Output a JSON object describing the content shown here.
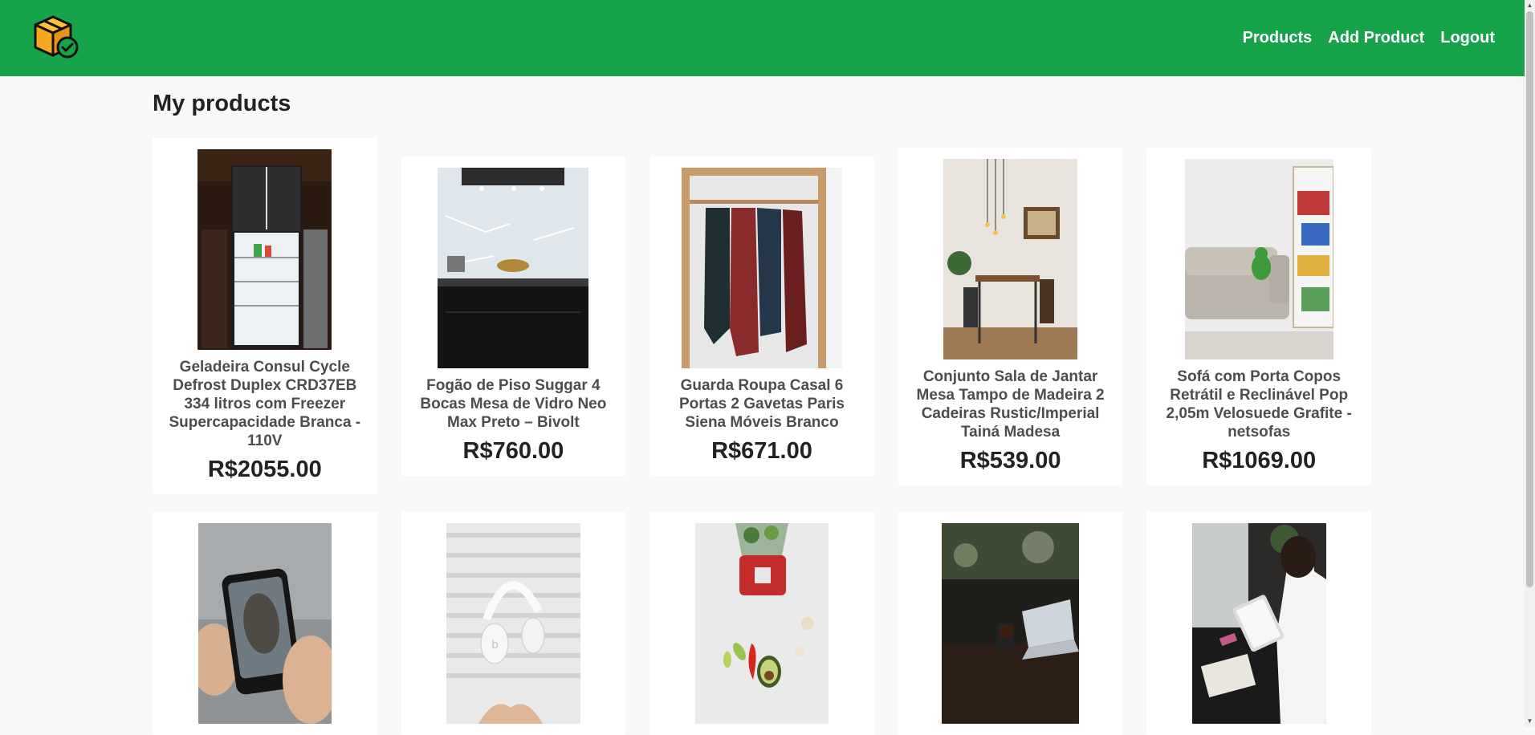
{
  "navbar": {
    "links": [
      "Products",
      "Add Product",
      "Logout"
    ],
    "brand_color": "#17a34a",
    "logo_icon": "package-check-icon"
  },
  "page": {
    "title": "My products"
  },
  "products": [
    {
      "name": "Geladeira Consul Cycle Defrost Duplex CRD37EB 334 litros com Freezer Supercapacidade Branca - 110V",
      "price": "R$2055.00",
      "image": "refrigerator-photo"
    },
    {
      "name": "Fogão de Piso Suggar 4 Bocas Mesa de Vidro Neo Max Preto – Bivolt",
      "price": "R$760.00",
      "image": "stove-photo"
    },
    {
      "name": "Guarda Roupa Casal 6 Portas 2 Gavetas Paris Siena Móveis Branco",
      "price": "R$671.00",
      "image": "wardrobe-photo"
    },
    {
      "name": "Conjunto Sala de Jantar Mesa Tampo de Madeira 2 Cadeiras Rustic/Imperial Tainá Madesa",
      "price": "R$539.00",
      "image": "dining-room-photo"
    },
    {
      "name": "Sofá com Porta Copos Retrátil e Reclinável Pop 2,05m Velosuede Grafite - netsofas",
      "price": "R$1069.00",
      "image": "sofa-photo"
    },
    {
      "image": "smartphone-photo"
    },
    {
      "image": "headphones-photo"
    },
    {
      "image": "blender-photo"
    },
    {
      "image": "cafe-laptop-photo"
    },
    {
      "image": "tablet-reading-photo"
    }
  ]
}
